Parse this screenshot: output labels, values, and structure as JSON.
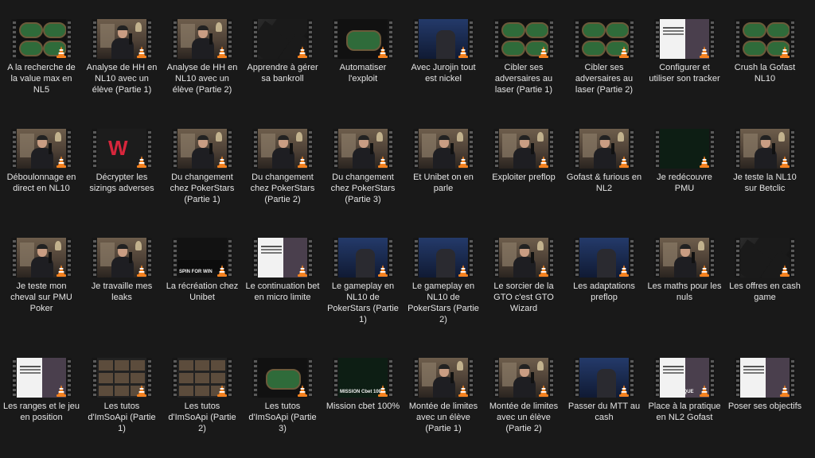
{
  "videos": [
    {
      "title": "A la recherche de la value max en NL5",
      "scene": "tables"
    },
    {
      "title": "Analyse de HH en NL10 avec un élève (Partie 1)",
      "scene": "room"
    },
    {
      "title": "Analyse de HH en NL10 avec un élève (Partie 2)",
      "scene": "room"
    },
    {
      "title": "Apprendre à gérer sa bankroll",
      "scene": "dark"
    },
    {
      "title": "Automatiser l'exploit",
      "scene": "table-screen"
    },
    {
      "title": "Avec Jurojin tout est nickel",
      "scene": "blue"
    },
    {
      "title": "Cibler ses adversaires au laser (Partie 1)",
      "scene": "tables"
    },
    {
      "title": "Cibler ses adversaires au laser (Partie 2)",
      "scene": "tables"
    },
    {
      "title": "Configurer et utiliser son tracker",
      "scene": "white"
    },
    {
      "title": "Crush la Gofast NL10",
      "scene": "tables"
    },
    {
      "title": "Déboulonnage en direct en NL10",
      "scene": "room"
    },
    {
      "title": "Décrypter les sizings adverses",
      "scene": "red"
    },
    {
      "title": "Du changement chez PokerStars (Partie 1)",
      "scene": "room"
    },
    {
      "title": "Du changement chez PokerStars (Partie 2)",
      "scene": "room"
    },
    {
      "title": "Du changement chez PokerStars (Partie 3)",
      "scene": "room"
    },
    {
      "title": "Et Unibet on en parle",
      "scene": "room"
    },
    {
      "title": "Exploiter preflop",
      "scene": "room"
    },
    {
      "title": "Gofast & furious en NL2",
      "scene": "room"
    },
    {
      "title": "Je redécouvre PMU",
      "scene": "green-tables"
    },
    {
      "title": "Je teste la NL10 sur Betclic",
      "scene": "room"
    },
    {
      "title": "Je teste mon cheval sur PMU Poker",
      "scene": "room"
    },
    {
      "title": "Je travaille mes leaks",
      "scene": "room"
    },
    {
      "title": "La récréation chez Unibet",
      "scene": "spin",
      "badge": "SPIN FOR WIN"
    },
    {
      "title": "Le continuation bet en micro limite",
      "scene": "white"
    },
    {
      "title": "Le gameplay en NL10 de PokerStars (Partie 1)",
      "scene": "blue"
    },
    {
      "title": "Le gameplay en NL10 de PokerStars (Partie 2)",
      "scene": "blue"
    },
    {
      "title": "Le sorcier de la GTO c'est GTO Wizard",
      "scene": "room"
    },
    {
      "title": "Les adaptations preflop",
      "scene": "blue"
    },
    {
      "title": "Les maths pour les nuls",
      "scene": "room"
    },
    {
      "title": "Les offres en cash game",
      "scene": "dark"
    },
    {
      "title": "Les ranges et le jeu en position",
      "scene": "white"
    },
    {
      "title": "Les tutos d'ImSoApi (Partie 1)",
      "scene": "multi"
    },
    {
      "title": "Les tutos d'ImSoApi (Partie 2)",
      "scene": "multi"
    },
    {
      "title": "Les tutos d'ImSoApi (Partie 3)",
      "scene": "table-screen"
    },
    {
      "title": "Mission cbet 100%",
      "scene": "green-tables",
      "badge": "MISSION Cbet 100%"
    },
    {
      "title": "Montée de limites avec un élève (Partie 1)",
      "scene": "room"
    },
    {
      "title": "Montée de limites avec un élève (Partie 2)",
      "scene": "room"
    },
    {
      "title": "Passer du MTT au cash",
      "scene": "blue"
    },
    {
      "title": "Place à la pratique en NL2 Gofast",
      "scene": "white",
      "badge": "EN PRATIQUE"
    },
    {
      "title": "Poser ses objectifs",
      "scene": "white"
    }
  ]
}
